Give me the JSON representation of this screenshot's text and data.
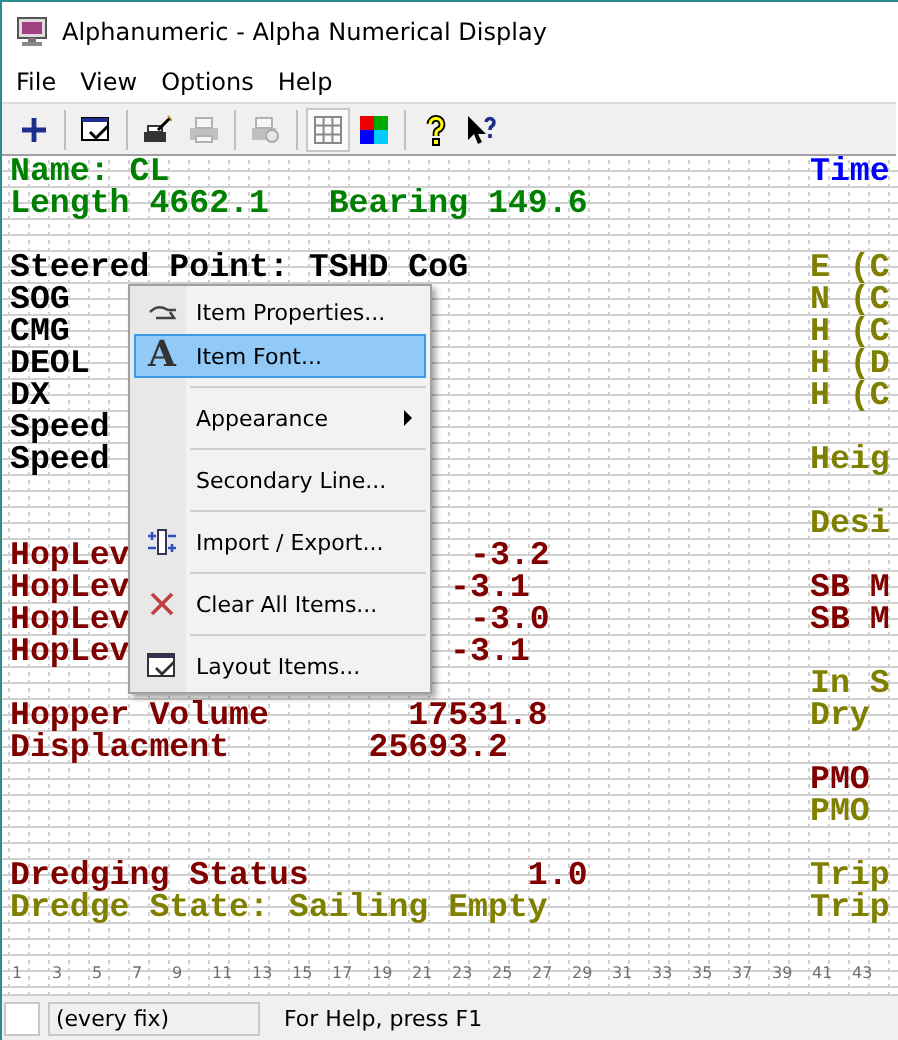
{
  "window": {
    "title": "Alphanumeric - Alpha Numerical Display"
  },
  "menu_bar": [
    "File",
    "View",
    "Options",
    "Help"
  ],
  "toolbar": [
    {
      "kind": "add",
      "disabled": false,
      "pressed": false
    },
    {
      "kind": "sep"
    },
    {
      "kind": "layout",
      "disabled": false,
      "pressed": false
    },
    {
      "kind": "sep"
    },
    {
      "kind": "wand",
      "disabled": false,
      "pressed": false
    },
    {
      "kind": "print",
      "disabled": true,
      "pressed": false
    },
    {
      "kind": "sep"
    },
    {
      "kind": "preview",
      "disabled": true,
      "pressed": false
    },
    {
      "kind": "sep"
    },
    {
      "kind": "grid",
      "disabled": false,
      "pressed": true
    },
    {
      "kind": "colors",
      "disabled": false,
      "pressed": false
    },
    {
      "kind": "sep"
    },
    {
      "kind": "help",
      "disabled": false,
      "pressed": false
    },
    {
      "kind": "whatsthis",
      "disabled": false,
      "pressed": false
    }
  ],
  "display": {
    "blocks": [
      [
        {
          "left": [
            {
              "text": "Name: CL",
              "color": "#008000"
            }
          ],
          "right": {
            "text": "Time",
            "color": "#0000ff"
          }
        },
        {
          "left": [
            {
              "text": "Length 4662.1   Bearing 149.6",
              "color": "#008000"
            }
          ]
        }
      ],
      [
        {
          "left": [
            {
              "text": "Steered Point: TSHD CoG",
              "color": "#000000"
            }
          ],
          "right": {
            "text": "E (C",
            "color": "#808000"
          }
        },
        {
          "left": [
            {
              "text": "SOG",
              "color": "#000000"
            }
          ],
          "right": {
            "text": "N (C",
            "color": "#808000"
          }
        },
        {
          "left": [
            {
              "text": "CMG",
              "color": "#000000"
            }
          ],
          "right": {
            "text": "H (C",
            "color": "#808000"
          }
        },
        {
          "left": [
            {
              "text": "DEOL",
              "color": "#000000"
            }
          ],
          "right": {
            "text": "H (D",
            "color": "#808000"
          }
        },
        {
          "left": [
            {
              "text": "DX",
              "color": "#000000"
            }
          ],
          "right": {
            "text": "H (C",
            "color": "#808000"
          }
        },
        {
          "left": [
            {
              "text": "Speed",
              "color": "#000000"
            }
          ]
        },
        {
          "left": [
            {
              "text": "Speed",
              "color": "#000000"
            }
          ],
          "right": {
            "text": "Heig",
            "color": "#808000"
          }
        }
      ],
      [
        {
          "right": {
            "text": "Desi",
            "color": "#808000"
          }
        },
        {
          "left": [
            {
              "text": "HopLev",
              "color": "#800000"
            },
            {
              "text": "-3.2",
              "color": "#800000"
            }
          ]
        },
        {
          "left": [
            {
              "text": "HopLev",
              "color": "#800000"
            },
            {
              "text": "-3.1",
              "color": "#800000"
            }
          ],
          "right": {
            "text": "SB M",
            "color": "#800000"
          }
        },
        {
          "left": [
            {
              "text": "HopLev",
              "color": "#800000"
            },
            {
              "text": "-3.0",
              "color": "#800000"
            }
          ],
          "right": {
            "text": "SB M",
            "color": "#800000"
          }
        },
        {
          "left": [
            {
              "text": "HopLev",
              "color": "#800000"
            },
            {
              "text": "-3.1",
              "color": "#800000"
            }
          ]
        },
        {
          "right": {
            "text": "In S",
            "color": "#808000"
          }
        },
        {
          "left": [
            {
              "text": "Hopper Volume       17531.8",
              "color": "#800000"
            }
          ],
          "right": {
            "text": "Dry",
            "color": "#808000"
          }
        },
        {
          "left": [
            {
              "text": "Displacment       25693.2",
              "color": "#800000"
            }
          ]
        },
        {
          "right": {
            "text": "PMO",
            "color": "#800000"
          }
        },
        {
          "right": {
            "text": "PMO",
            "color": "#808000"
          }
        }
      ],
      [
        {
          "left": [
            {
              "text": "Dredging Status           1.0",
              "color": "#800000"
            }
          ],
          "right": {
            "text": "Trip",
            "color": "#808000"
          }
        },
        {
          "left": [
            {
              "text": "Dredge State: Sailing Empty",
              "color": "#808000"
            }
          ],
          "right": {
            "text": "Trip",
            "color": "#808000"
          }
        }
      ]
    ],
    "ruler": [
      "1",
      "3",
      "5",
      "7",
      "9",
      "11",
      "13",
      "15",
      "17",
      "19",
      "21",
      "23",
      "25",
      "27",
      "29",
      "31",
      "33",
      "35",
      "37",
      "39",
      "41",
      "43"
    ]
  },
  "context_menu": [
    {
      "kind": "item",
      "label": "Item Properties...",
      "selected": false
    },
    {
      "kind": "item",
      "glyph": "A",
      "label": "Item Font...",
      "selected": true
    },
    {
      "kind": "separator"
    },
    {
      "kind": "submenu",
      "label": "Appearance",
      "selected": false
    },
    {
      "kind": "separator"
    },
    {
      "kind": "item",
      "label": "Secondary Line...",
      "selected": false
    },
    {
      "kind": "separator"
    },
    {
      "kind": "item",
      "label": "Import / Export...",
      "selected": false
    },
    {
      "kind": "separator"
    },
    {
      "kind": "item",
      "label": "Clear All Items...",
      "selected": false
    },
    {
      "kind": "separator"
    },
    {
      "kind": "item",
      "label": "Layout Items...",
      "selected": false
    }
  ],
  "status_bar": [
    "(every fix)",
    "For Help, press F1"
  ]
}
